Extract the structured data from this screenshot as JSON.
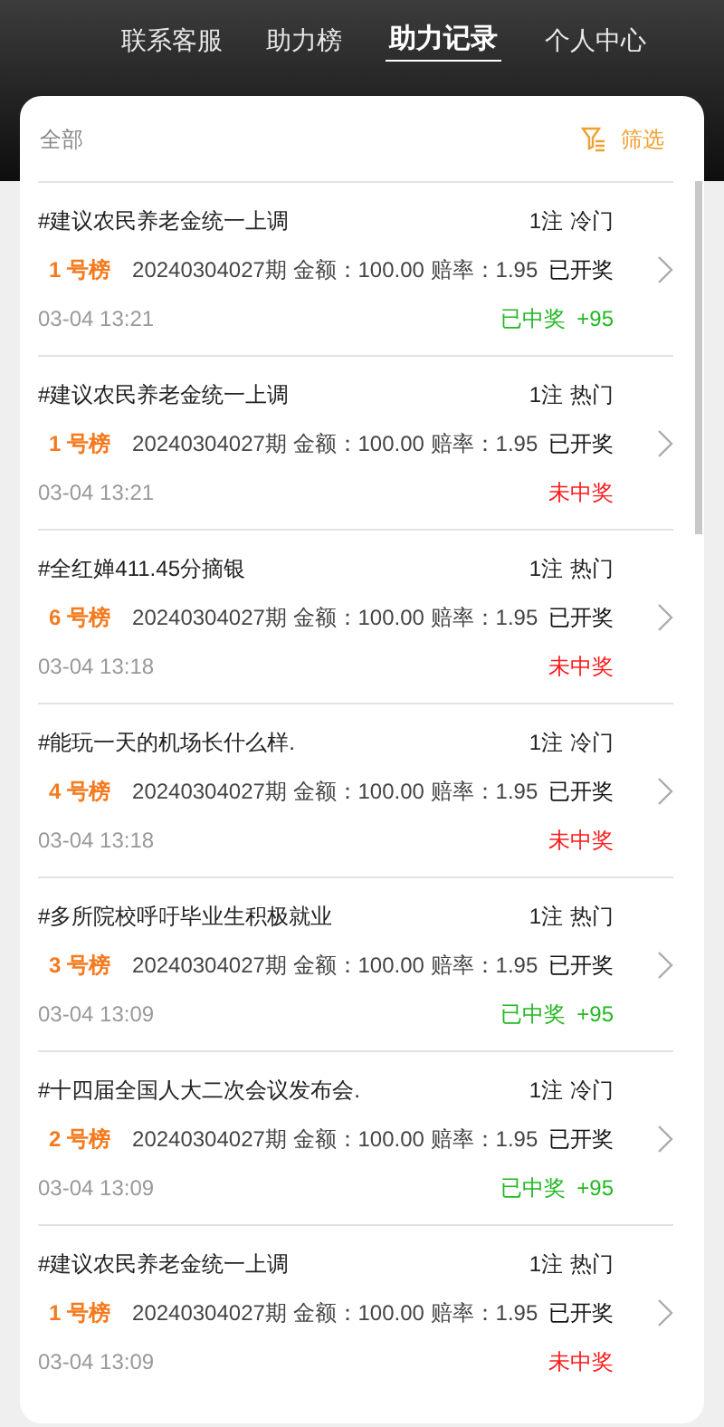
{
  "nav": [
    {
      "label": "联系客服",
      "selected": false
    },
    {
      "label": "助力榜",
      "selected": false
    },
    {
      "label": "助力记录",
      "selected": true
    },
    {
      "label": "个人中心",
      "selected": false
    }
  ],
  "filter_bar": {
    "category": "全部",
    "filter_button": "筛选"
  },
  "records": [
    {
      "topic": "#建议农民养老金统一上调",
      "count": "1注",
      "heat": "冷门",
      "board": "1 号榜",
      "details": "20240304027期 金额：100.00 赔率：1.95",
      "status": "已开奖",
      "time": "03-04 13:21",
      "result": {
        "kind": "won",
        "text": "已中奖",
        "bonus": "+95"
      }
    },
    {
      "topic": "#建议农民养老金统一上调",
      "count": "1注",
      "heat": "热门",
      "board": "1 号榜",
      "details": "20240304027期 金额：100.00 赔率：1.95",
      "status": "已开奖",
      "time": "03-04 13:21",
      "result": {
        "kind": "lost",
        "text": "未中奖"
      }
    },
    {
      "topic": "#全红婵411.45分摘银",
      "count": "1注",
      "heat": "热门",
      "board": "6 号榜",
      "details": "20240304027期 金额：100.00 赔率：1.95",
      "status": "已开奖",
      "time": "03-04 13:18",
      "result": {
        "kind": "lost",
        "text": "未中奖"
      }
    },
    {
      "topic": "#能玩一天的机场长什么样.",
      "count": "1注",
      "heat": "冷门",
      "board": "4 号榜",
      "details": "20240304027期 金额：100.00 赔率：1.95",
      "status": "已开奖",
      "time": "03-04 13:18",
      "result": {
        "kind": "lost",
        "text": "未中奖"
      }
    },
    {
      "topic": "#多所院校呼吁毕业生积极就业",
      "count": "1注",
      "heat": "热门",
      "board": "3 号榜",
      "details": "20240304027期 金额：100.00 赔率：1.95",
      "status": "已开奖",
      "time": "03-04 13:09",
      "result": {
        "kind": "won",
        "text": "已中奖",
        "bonus": "+95"
      }
    },
    {
      "topic": "#十四届全国人大二次会议发布会.",
      "count": "1注",
      "heat": "冷门",
      "board": "2 号榜",
      "details": "20240304027期 金额：100.00 赔率：1.95",
      "status": "已开奖",
      "time": "03-04 13:09",
      "result": {
        "kind": "won",
        "text": "已中奖",
        "bonus": "+95"
      }
    },
    {
      "topic": "#建议农民养老金统一上调",
      "count": "1注",
      "heat": "热门",
      "board": "1 号榜",
      "details": "20240304027期 金额：100.00 赔率：1.95",
      "status": "已开奖",
      "time": "03-04 13:09",
      "result": {
        "kind": "lost",
        "text": "未中奖"
      }
    }
  ]
}
